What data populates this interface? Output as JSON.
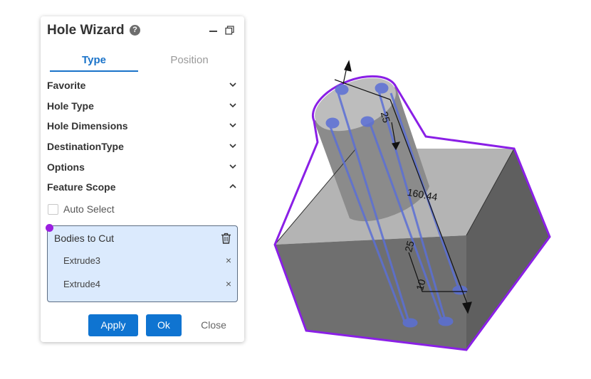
{
  "panel": {
    "title": "Hole Wizard",
    "help_icon": "?",
    "tabs": [
      {
        "label": "Type",
        "active": true
      },
      {
        "label": "Position",
        "active": false
      }
    ],
    "sections": [
      {
        "label": "Favorite",
        "expanded": false
      },
      {
        "label": "Hole Type",
        "expanded": false
      },
      {
        "label": "Hole Dimensions",
        "expanded": false
      },
      {
        "label": "DestinationType",
        "expanded": false
      },
      {
        "label": "Options",
        "expanded": false
      },
      {
        "label": "Feature Scope",
        "expanded": true
      }
    ],
    "auto_select": {
      "label": "Auto Select",
      "checked": false
    },
    "bodies_to_cut": {
      "title": "Bodies to Cut",
      "items": [
        "Extrude3",
        "Extrude4"
      ],
      "remove_symbol": "×"
    },
    "buttons": {
      "apply": "Apply",
      "ok": "Ok",
      "close": "Close"
    }
  },
  "viewport": {
    "dimensions": [
      "25",
      "160.44",
      "25",
      "10"
    ],
    "colors": {
      "selection": "#8a1fe6",
      "holes": "#5b6fd6",
      "body": "#9a9a9a"
    }
  }
}
